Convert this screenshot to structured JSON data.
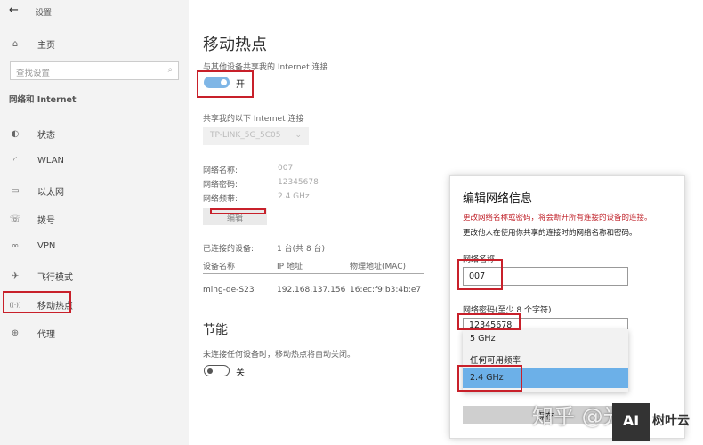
{
  "app": {
    "title": "设置",
    "back": "←"
  },
  "sidebar": {
    "home": "主页",
    "search_placeholder": "查找设置",
    "section": "网络和 Internet",
    "items": [
      {
        "label": "状态",
        "icon": "globe-status-icon",
        "glyph": "◐"
      },
      {
        "label": "WLAN",
        "icon": "wifi-icon",
        "glyph": "◜"
      },
      {
        "label": "以太网",
        "icon": "ethernet-icon",
        "glyph": "▭"
      },
      {
        "label": "拨号",
        "icon": "dialup-icon",
        "glyph": "☏"
      },
      {
        "label": "VPN",
        "icon": "vpn-icon",
        "glyph": "∞"
      },
      {
        "label": "飞行模式",
        "icon": "airplane-icon",
        "glyph": "✈"
      },
      {
        "label": "移动热点",
        "icon": "hotspot-icon",
        "glyph": "((·))"
      },
      {
        "label": "代理",
        "icon": "proxy-globe-icon",
        "glyph": "⊕"
      }
    ]
  },
  "main": {
    "title": "移动热点",
    "share_label": "与其他设备共享我的 Internet 连接",
    "toggle_state": "开",
    "share_from_label": "共享我的以下 Internet 连接",
    "share_from_value": "TP-LINK_5G_5C05",
    "props": [
      {
        "k": "网络名称:",
        "v": "007"
      },
      {
        "k": "网络密码:",
        "v": "12345678"
      },
      {
        "k": "网络频带:",
        "v": "2.4 GHz"
      }
    ],
    "edit": "编辑",
    "connected_label": "已连接的设备:",
    "connected_value": "1 台(共 8 台)",
    "columns": [
      "设备名称",
      "IP 地址",
      "物理地址(MAC)"
    ],
    "rows": [
      [
        "ming-de-S23",
        "192.168.137.156",
        "16:ec:f9:b3:4b:e7"
      ]
    ],
    "power_title": "节能",
    "power_desc": "未连接任何设备时，移动热点将自动关闭。",
    "power_state": "关"
  },
  "dialog": {
    "title": "编辑网络信息",
    "warning": "更改网络名称或密码，将会断开所有连接的设备的连接。",
    "desc": "更改他人在使用你共享的连接时的网络名称和密码。",
    "name_label": "网络名称",
    "name_value": "007",
    "pwd_label": "网络密码(至少 8 个字符)",
    "pwd_value": "12345678",
    "band_options": [
      "5 GHz",
      "任何可用频率",
      "2.4 GHz"
    ],
    "band_selected": "2.4 GHz",
    "save": "保存"
  },
  "watermark": {
    "text": "知乎 @光",
    "logo": "AI",
    "logo_text": "树叶云"
  },
  "colors": {
    "accent": "#6cb0e8",
    "toggle_on": "#7fb6e6",
    "warning": "#c0222a",
    "highlight": "#c8202a"
  }
}
